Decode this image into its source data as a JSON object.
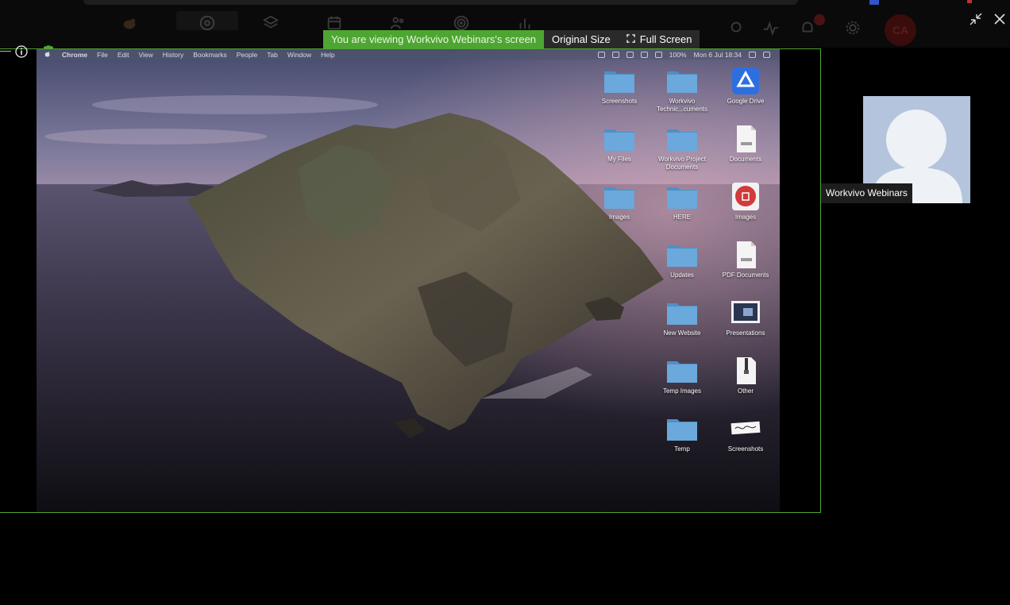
{
  "banner": {
    "viewing_text": "You are viewing Workvivo Webinars's screen",
    "original_size_label": "Original Size",
    "full_screen_label": "Full Screen"
  },
  "participant": {
    "name": "Workvivo Webinars"
  },
  "app_bar": {
    "avatar_initials": "CA"
  },
  "mac_menubar": {
    "app_name": "Chrome",
    "menu_items": [
      "File",
      "Edit",
      "View",
      "History",
      "Bookmarks",
      "People",
      "Tab",
      "Window",
      "Help"
    ],
    "battery": "100%",
    "datetime": "Mon 6 Jul 18:34"
  },
  "desktop_items": [
    {
      "label": "Screenshots",
      "icon": "folder"
    },
    {
      "label": "Workvivo Technic...cuments",
      "icon": "folder"
    },
    {
      "label": "Google Drive",
      "icon": "google-drive"
    },
    {
      "label": "My Files",
      "icon": "folder"
    },
    {
      "label": "Workvivo Project Documents",
      "icon": "folder"
    },
    {
      "label": "Documents",
      "icon": "document"
    },
    {
      "label": "Images",
      "icon": "folder"
    },
    {
      "label": "HERE",
      "icon": "folder"
    },
    {
      "label": "Images",
      "icon": "app-red"
    },
    {
      "label": "Updates",
      "icon": "folder"
    },
    {
      "label": "PDF Documents",
      "icon": "document"
    },
    {
      "label": "New Website",
      "icon": "folder"
    },
    {
      "label": "Presentations",
      "icon": "image-file"
    },
    {
      "label": "Temp Images",
      "icon": "folder"
    },
    {
      "label": "Other",
      "icon": "zip"
    },
    {
      "label": "Temp",
      "icon": "folder"
    },
    {
      "label": "Screenshots",
      "icon": "signature-image"
    }
  ],
  "colors": {
    "accent_green": "#4ea632",
    "frame_border": "#4ea632"
  }
}
